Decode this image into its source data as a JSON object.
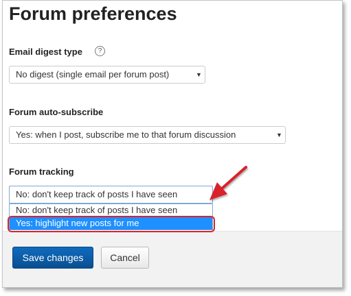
{
  "page": {
    "title": "Forum preferences"
  },
  "fields": [
    {
      "label": "Email digest type",
      "help_icon": "question-circle-icon",
      "value": "No digest (single email per forum post)"
    },
    {
      "label": "Forum auto-subscribe",
      "value": "Yes: when I post, subscribe me to that forum discussion"
    },
    {
      "label": "Forum tracking",
      "value": "No: don't keep track of posts I have seen",
      "dropdown_open": true,
      "options": [
        "No: don't keep track of posts I have seen",
        "Yes: highlight new posts for me"
      ],
      "highlighted_option_index": 1
    }
  ],
  "buttons": {
    "save": "Save changes",
    "cancel": "Cancel"
  },
  "annotations": {
    "arrow_color": "#d9232a",
    "highlight_box_color": "#d9232a"
  },
  "colors": {
    "primary_button": "#0f6bbd",
    "selected_option": "#1e90ff",
    "footer_background": "#f2f2f2"
  }
}
